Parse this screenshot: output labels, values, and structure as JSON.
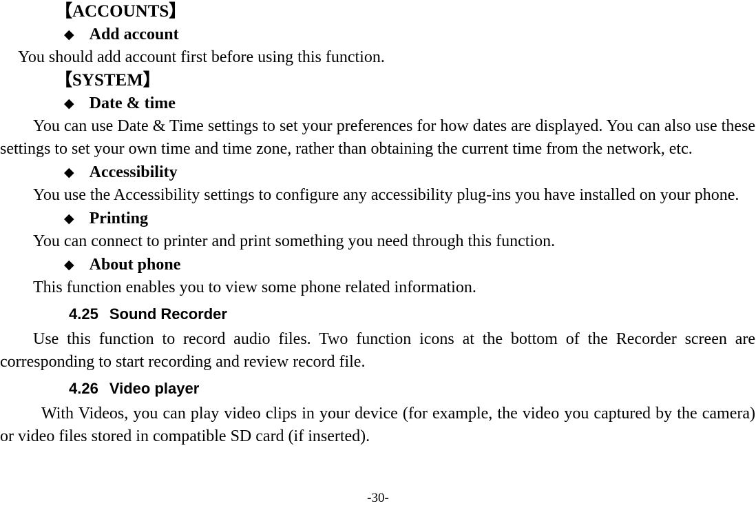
{
  "document": {
    "page_number_label": "-30-",
    "bullet_glyph": "◆",
    "blocks": {
      "accounts_label": "【ACCOUNTS】",
      "add_account_bullet": "Add account",
      "add_account_text": "You should add account first before using this function.",
      "system_label": "【SYSTEM】",
      "date_time_bullet": "Date & time",
      "date_time_text": "You can use Date & Time settings to set your preferences for how dates are displayed. You can also use these settings to set your own time and time zone, rather than obtaining the current time from the network, etc.",
      "accessibility_bullet": "Accessibility",
      "accessibility_text": "You use the Accessibility settings to configure any accessibility plug-ins you have installed on your phone.",
      "printing_bullet": "Printing",
      "printing_text": "You can connect to printer and print something you need through this function.",
      "about_phone_bullet": "About phone",
      "about_phone_text": "This function enables you to view some phone related information.",
      "sound_recorder_number": "4.25",
      "sound_recorder_title": "Sound Recorder",
      "sound_recorder_text": "Use this function to record audio files. Two function icons at the bottom of the Recorder screen are corresponding to start recording and review record file.",
      "video_player_number": "4.26",
      "video_player_title": "Video player",
      "video_player_text": "With Videos, you can play video clips in your device (for example, the video you captured by the camera) or video files stored in compatible SD card (if inserted)."
    }
  }
}
